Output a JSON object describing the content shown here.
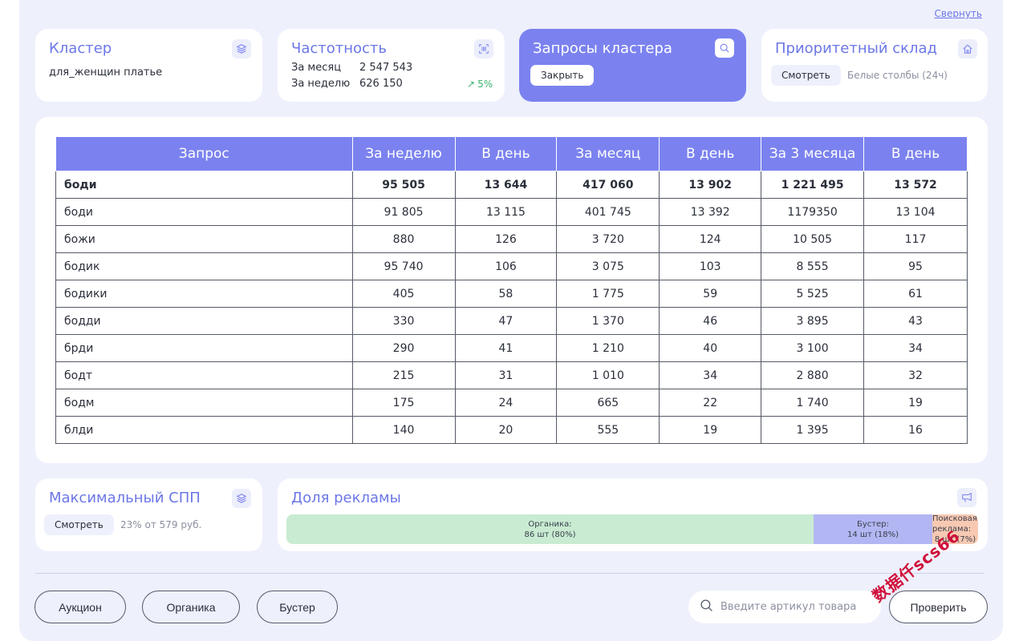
{
  "header": {
    "collapse_label": "Свернуть"
  },
  "cards": {
    "cluster": {
      "title": "Кластер",
      "value": "для_женщин платье",
      "icon": "layers-icon"
    },
    "frequency": {
      "title": "Частотность",
      "month_label": "За месяц",
      "month_value": "2 547 543",
      "week_label": "За неделю",
      "week_value": "626 150",
      "trend": "5%",
      "icon": "barcode-icon"
    },
    "queries": {
      "title": "Запросы кластера",
      "button": "Закрыть",
      "icon": "search-icon"
    },
    "warehouse": {
      "title": "Приоритетный склад",
      "button": "Смотреть",
      "value": "Белые столбы (24ч)",
      "icon": "home-icon"
    }
  },
  "table": {
    "headers": [
      "Запрос",
      "За неделю",
      "В день",
      "За месяц",
      "В день",
      "За 3 месяца",
      "В день"
    ],
    "rows": [
      [
        "боди",
        "95 505",
        "13 644",
        "417 060",
        "13 902",
        "1 221 495",
        "13 572"
      ],
      [
        "боди",
        "91 805",
        "13 115",
        "401 745",
        "13 392",
        "1179350",
        "13 104"
      ],
      [
        "божи",
        "880",
        "126",
        "3 720",
        "124",
        "10 505",
        "117"
      ],
      [
        "бодик",
        "95 740",
        "106",
        "3 075",
        "103",
        "8 555",
        "95"
      ],
      [
        "бодики",
        "405",
        "58",
        "1 775",
        "59",
        "5 525",
        "61"
      ],
      [
        "бодди",
        "330",
        "47",
        "1 370",
        "46",
        "3 895",
        "43"
      ],
      [
        "брди",
        "290",
        "41",
        "1 210",
        "40",
        "3 100",
        "34"
      ],
      [
        "бодт",
        "215",
        "31",
        "1 010",
        "34",
        "2 880",
        "32"
      ],
      [
        "бодм",
        "175",
        "24",
        "665",
        "22",
        "1 740",
        "19"
      ],
      [
        "блди",
        "140",
        "20",
        "555",
        "19",
        "1 395",
        "16"
      ]
    ]
  },
  "spp": {
    "title": "Максимальный СПП",
    "button": "Смотреть",
    "value": "23% от 579 руб.",
    "icon": "layers-icon"
  },
  "ads": {
    "title": "Доля рекламы",
    "icon": "megaphone-icon",
    "segments": [
      {
        "label": "Органика:",
        "value": "86 шт (80%)",
        "share": 0.8,
        "color": "#c8ebd2"
      },
      {
        "label": "Бустер:",
        "value": "14 шт (18%)",
        "share": 0.18,
        "color": "#b2b6f2"
      },
      {
        "label": "Поисковая реклама:",
        "value": "8 шт (7%)",
        "share": 0.07,
        "color": "#f7c9b2"
      }
    ]
  },
  "footer": {
    "auction": "Аукцион",
    "organic": "Органика",
    "booster": "Бустер",
    "search_placeholder": "Введите артикул товара",
    "check": "Проверить"
  },
  "watermark": "数据仟scs66",
  "colors": {
    "accent": "#7b82ef",
    "accent_text": "#6c77e6",
    "background": "#eef0fc"
  }
}
